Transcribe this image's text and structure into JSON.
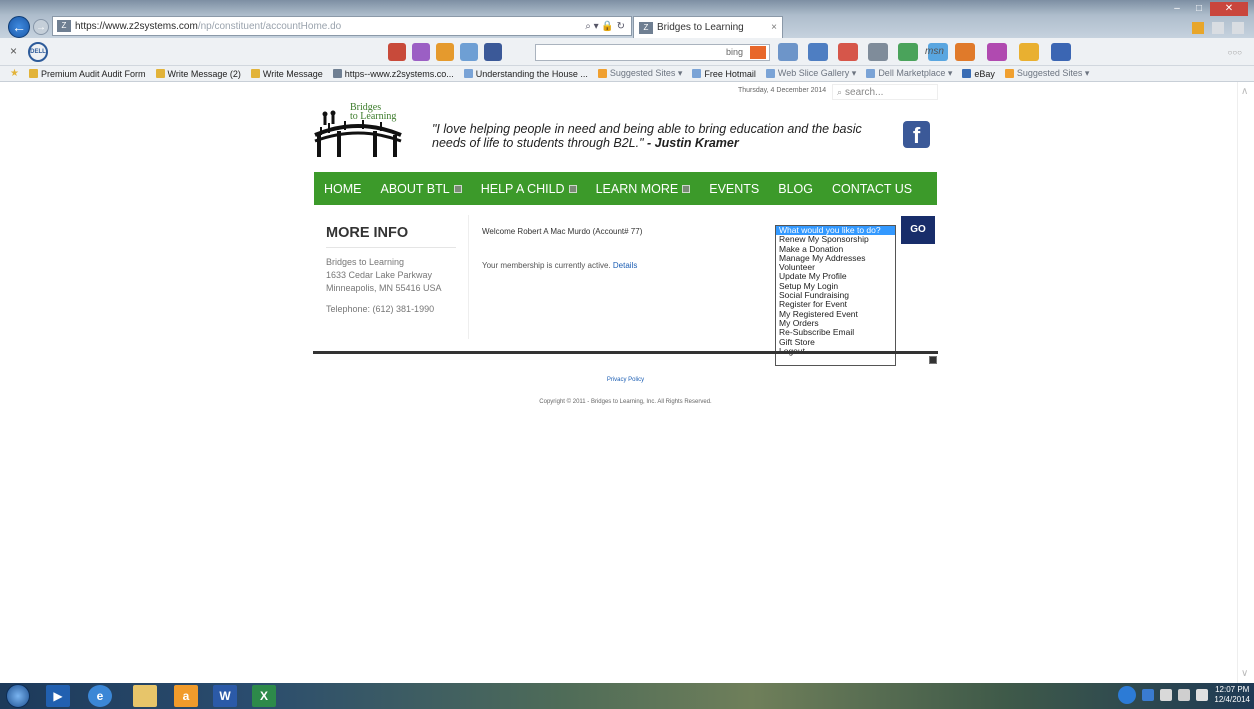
{
  "browser": {
    "url": "https://www.z2systems.com",
    "url_tail": "/np/constituent/accountHome.do",
    "tab_title": "Bridges to Learning",
    "bing_label": "bing",
    "toolbar_msn": "msn"
  },
  "favorites": [
    "Premium Audit Audit Form",
    "Write Message (2)",
    "Write Message",
    "https--www.z2systems.co...",
    "Understanding the House ...",
    "Suggested Sites ▾",
    "Free Hotmail",
    "Web Slice Gallery ▾",
    "Dell Marketplace ▾",
    "eBay",
    "Suggested Sites ▾"
  ],
  "page": {
    "date": "Thursday, 4 December 2014",
    "search_placeholder": "search...",
    "logo_line1": "Bridges",
    "logo_line2": "to Learning",
    "quote": "\"I love helping people in need and being able to bring education and the basic needs of life to students through B2L.\"",
    "quote_author": "- Justin Kramer",
    "facebook_glyph": "f"
  },
  "nav": {
    "items": [
      {
        "label": "HOME",
        "has_submenu": false
      },
      {
        "label": "ABOUT BTL",
        "has_submenu": true
      },
      {
        "label": "HELP A CHILD",
        "has_submenu": true
      },
      {
        "label": "LEARN MORE",
        "has_submenu": true
      },
      {
        "label": "EVENTS",
        "has_submenu": false
      },
      {
        "label": "BLOG",
        "has_submenu": false
      },
      {
        "label": "CONTACT US",
        "has_submenu": false
      }
    ]
  },
  "sidebar": {
    "title": "MORE INFO",
    "org": "Bridges to Learning",
    "street": "1633 Cedar Lake Parkway",
    "city": "Minneapolis, MN 55416 USA",
    "phone": "Telephone: (612) 381-1990"
  },
  "account": {
    "welcome": "Welcome Robert A Mac Murdo (Account# 77)",
    "membership_text": "Your membership is currently active.",
    "details_link": "Details"
  },
  "action_menu": {
    "selected": "What would you like to do?",
    "options": [
      "What would you like to do?",
      "Renew My Sponsorship",
      "Make a Donation",
      "Manage My Addresses",
      "Volunteer",
      "Update My Profile",
      "Setup My Login",
      "Social Fundraising",
      "Register for Event",
      "My Registered Event",
      "My Orders",
      "Re-Subscribe Email",
      "Gift Store",
      "Logout"
    ],
    "go_label": "GO"
  },
  "footer": {
    "privacy": "Privacy Policy",
    "copyright": "Copyright © 2011 - Bridges to Learning, Inc. All Rights Reserved."
  },
  "taskbar": {
    "time": "12:07 PM",
    "date": "12/4/2014"
  },
  "colors": {
    "nav_green": "#3c9a2a",
    "go_navy": "#182d6a",
    "link_blue": "#1d5fb4",
    "selected_blue": "#3399ff",
    "facebook_blue": "#3b5998"
  }
}
